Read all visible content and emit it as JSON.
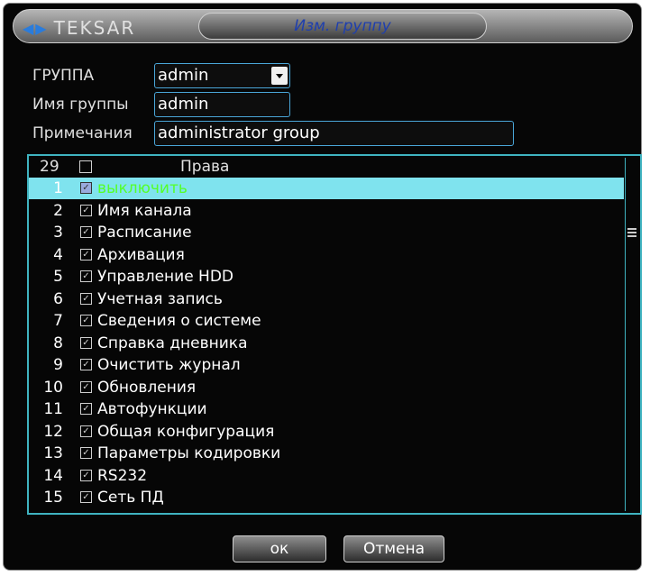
{
  "window": {
    "logo": "TEKSAR",
    "title": "Изм. группу"
  },
  "form": {
    "group_label": "ГРУППА",
    "group_value": "admin",
    "name_label": "Имя группы",
    "name_value": "admin",
    "notes_label": "Примечания",
    "notes_value": "administrator group"
  },
  "rights": {
    "count": "29",
    "header": "Права",
    "items": [
      {
        "num": "1",
        "label": "выключить",
        "selected": true
      },
      {
        "num": "2",
        "label": "Имя канала"
      },
      {
        "num": "3",
        "label": "Расписание"
      },
      {
        "num": "4",
        "label": "Архивация"
      },
      {
        "num": "5",
        "label": "Управление HDD"
      },
      {
        "num": "6",
        "label": "Учетная запись"
      },
      {
        "num": "7",
        "label": "Сведения о системе"
      },
      {
        "num": "8",
        "label": "Справка дневника"
      },
      {
        "num": "9",
        "label": "Очистить журнал"
      },
      {
        "num": "10",
        "label": "Обновления"
      },
      {
        "num": "11",
        "label": "Автофункции"
      },
      {
        "num": "12",
        "label": "Общая конфигурация"
      },
      {
        "num": "13",
        "label": "Параметры кодировки"
      },
      {
        "num": "14",
        "label": "RS232"
      },
      {
        "num": "15",
        "label": "Сеть ПД"
      }
    ]
  },
  "buttons": {
    "ok": "ок",
    "cancel": "Отмена"
  },
  "colors": {
    "accent": "#3fb3c0",
    "selected_row": "#7fe3ee",
    "selected_text": "#55ff2a",
    "title_text": "#1f3fae"
  }
}
